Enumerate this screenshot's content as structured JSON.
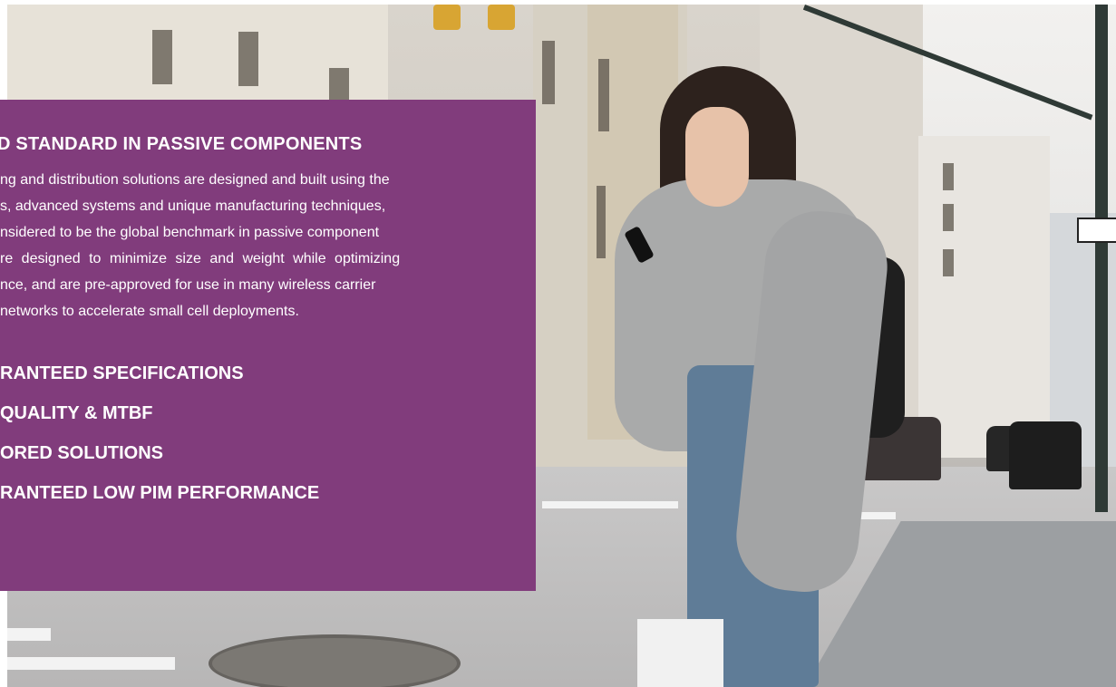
{
  "hero": {
    "image_description_tag": "city-street-woman-phone"
  },
  "panel": {
    "background_color": "#813c7c",
    "heading": "D STANDARD IN PASSIVE COMPONENTS",
    "description_lines": [
      "ng and distribution solutions are designed and built using the",
      "s, advanced systems and unique manufacturing techniques,",
      "nsidered to be the global benchmark in passive component",
      "re designed to minimize size and weight while optimizing",
      "nce, and are pre-approved for use in many wireless carrier",
      "networks to accelerate small cell deployments."
    ],
    "features": [
      "RANTEED SPECIFICATIONS",
      "QUALITY & MTBF",
      "ORED SOLUTIONS",
      "RANTEED LOW PIM PERFORMANCE"
    ]
  }
}
